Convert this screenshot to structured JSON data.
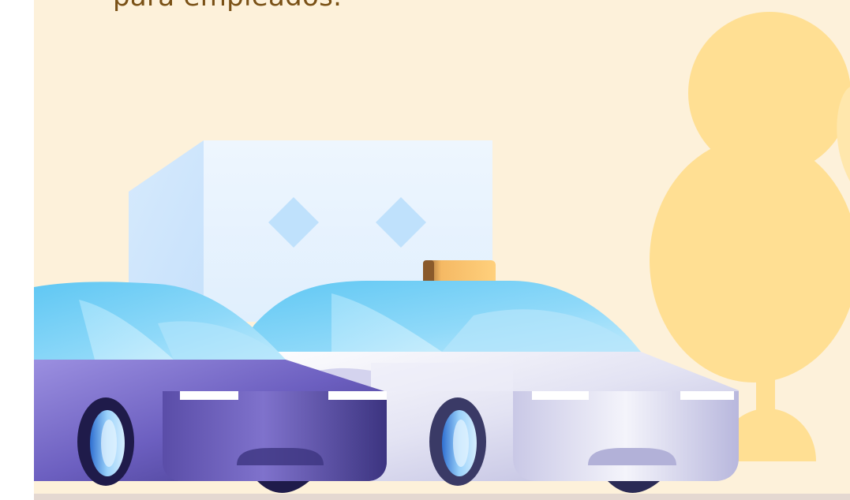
{
  "headline": {
    "text": "para empleados."
  },
  "colors": {
    "background": "#fdf1da",
    "headline": "#7a5116",
    "tree": "#ffdf93",
    "building": "#e3f1fd",
    "window": "#bfe1fc",
    "purple_car_body": "#5a4da3",
    "white_car_body": "#dcdcee",
    "windshield": "#8ad7f8",
    "taxi_sign": "#f9c871"
  },
  "illustration": {
    "elements": [
      "tree",
      "building",
      "purple-car",
      "taxi-car"
    ]
  }
}
